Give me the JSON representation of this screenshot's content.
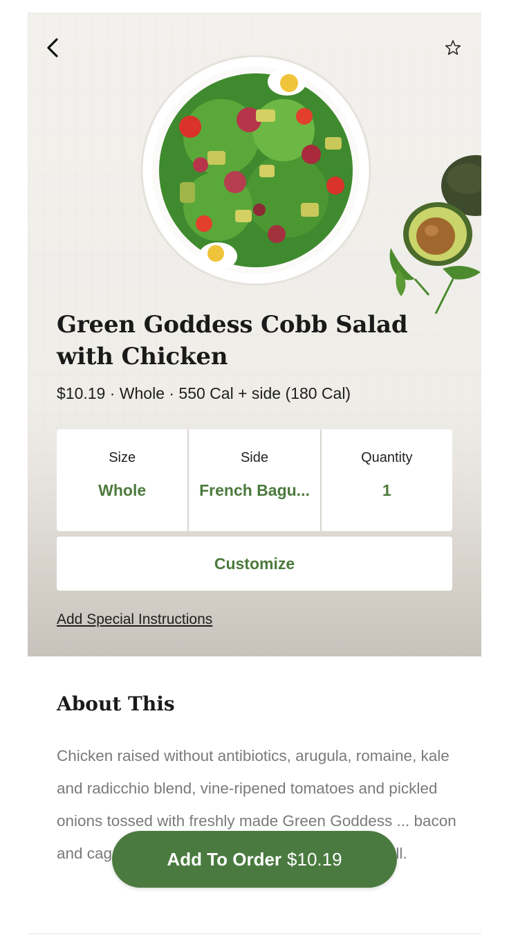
{
  "icons": {
    "back": "chevron-left-icon",
    "favorite": "star-outline-icon"
  },
  "product": {
    "name": "Green Goddess Cobb Salad with Chicken",
    "meta": "$10.19 · Whole · 550 Cal + side (180 Cal)"
  },
  "options": [
    {
      "label": "Size",
      "value": "Whole"
    },
    {
      "label": "Side",
      "value": "French Bagu..."
    },
    {
      "label": "Quantity",
      "value": "1"
    }
  ],
  "customize_label": "Customize",
  "special_instructions_label": "Add Special Instructions",
  "about": {
    "title": "About This",
    "text": "Chicken raised without antibiotics, arugula, romaine, kale and radicchio blend, vine-ripened tomatoes and pickled onions tossed with freshly made Green Goddess ... bacon and cage-free hard-boiled egg pasteurized in shell."
  },
  "add_to_order": {
    "label": "Add To Order",
    "price": "$10.19"
  },
  "colors": {
    "accent": "#4a7a3f",
    "accent_text": "#4c7a3c"
  }
}
